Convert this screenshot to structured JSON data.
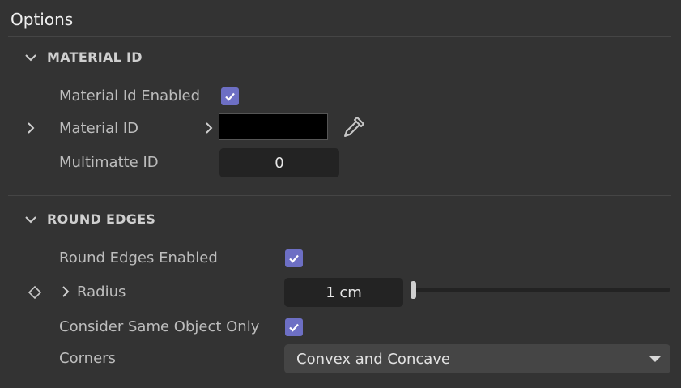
{
  "panel": {
    "title": "Options"
  },
  "material_id": {
    "header": "MATERIAL ID",
    "enabled_label": "Material Id Enabled",
    "enabled": true,
    "material_id_label": "Material ID",
    "material_id_color": "#000000",
    "multimatte_label": "Multimatte ID",
    "multimatte_value": "0"
  },
  "round_edges": {
    "header": "ROUND EDGES",
    "enabled_label": "Round Edges Enabled",
    "enabled": true,
    "radius_label": "Radius",
    "radius_value": "1 cm",
    "consider_label": "Consider Same Object Only",
    "consider": true,
    "corners_label": "Corners",
    "corners_value": "Convex and Concave"
  },
  "colors": {
    "accent": "#6d6fc4",
    "background": "#333333",
    "field": "#232323"
  }
}
